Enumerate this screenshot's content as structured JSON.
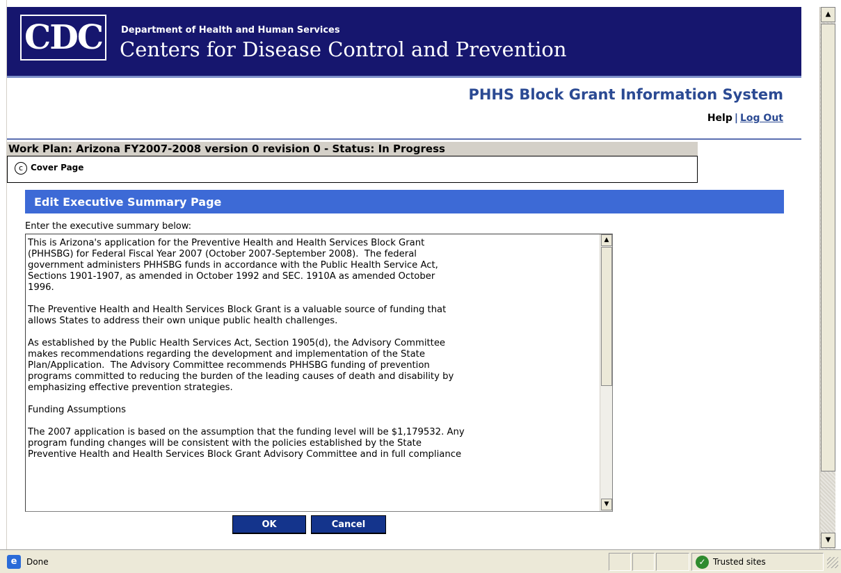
{
  "header": {
    "logo_text": "CDC",
    "department": "Department of Health and Human Services",
    "org_name": "Centers for Disease Control and Prevention",
    "system_title": "PHHS Block Grant Information System",
    "help_label": "Help",
    "separator": "|",
    "logout_label": "Log Out"
  },
  "workplan": {
    "title": "Work Plan: Arizona FY2007-2008 version 0 revision 0 - Status: In Progress",
    "cover_icon": "copyright-c-icon",
    "cover_label": "Cover Page"
  },
  "editor": {
    "section_title": "Edit Executive Summary Page",
    "prompt": "Enter the executive summary below:",
    "text": "This is Arizona's application for the Preventive Health and Health Services Block Grant\n(PHHSBG) for Federal Fiscal Year 2007 (October 2007-September 2008).  The federal\ngovernment administers PHHSBG funds in accordance with the Public Health Service Act,\nSections 1901-1907, as amended in October 1992 and SEC. 1910A as amended October\n1996.\n\nThe Preventive Health and Health Services Block Grant is a valuable source of funding that\nallows States to address their own unique public health challenges.\n\nAs established by the Public Health Services Act, Section 1905(d), the Advisory Committee\nmakes recommendations regarding the development and implementation of the State\nPlan/Application.  The Advisory Committee recommends PHHSBG funding of prevention\nprograms committed to reducing the burden of the leading causes of death and disability by\nemphasizing effective prevention strategies.\n\nFunding Assumptions\n\nThe 2007 application is based on the assumption that the funding level will be $1,179532. Any\nprogram funding changes will be consistent with the policies established by the State\nPreventive Health and Health Services Block Grant Advisory Committee and in full compliance",
    "ok_label": "OK",
    "cancel_label": "Cancel"
  },
  "statusbar": {
    "status_text": "Done",
    "zone_label": "Trusted sites"
  },
  "colors": {
    "banner": "#16166e",
    "section_header": "#3d6ad6",
    "link": "#2b4a93",
    "button": "#14348c"
  }
}
